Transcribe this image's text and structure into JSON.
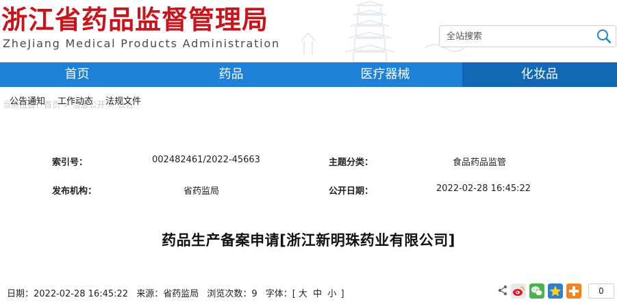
{
  "header": {
    "title": "浙江省药品监督管理局",
    "subtitle": "ZheJiang Medical Products Administration",
    "search": {
      "placeholder": "全站搜索",
      "icon": "search-icon"
    }
  },
  "nav": {
    "items": [
      {
        "label": "首页"
      },
      {
        "label": "药品"
      },
      {
        "label": "医疗器械"
      },
      {
        "label": "化妆品"
      }
    ],
    "active_index": 3,
    "color": "#1e80d6",
    "active_color": "#1368b6"
  },
  "breadcrumb_ghost": "当前位置：首页 > 信息公开 > 公告",
  "submenu": {
    "items": [
      {
        "label": "公告通知"
      },
      {
        "label": "工作动态"
      },
      {
        "label": "法规文件"
      }
    ]
  },
  "meta": {
    "index_label": "索引号：",
    "index_value": "002482461/2022-45663",
    "topic_label": "主题分类：",
    "topic_value": "食品药品监管",
    "issuer_label": "发布机构：",
    "issuer_value": "省药监局",
    "date_label": "公开日期：",
    "date_value": "2022-02-28 16:45:22"
  },
  "article": {
    "title": "药品生产备案申请[浙江新明珠药业有限公司]"
  },
  "infobar": {
    "date": "日期：2022-02-28 16:45:22",
    "source": "来源：省药监局",
    "views": "浏览次数：9",
    "font_label": "字体：[",
    "font_large": "大",
    "font_medium": "中",
    "font_small": "小",
    "font_end": "]"
  },
  "share": {
    "icons": [
      "share-icon",
      "weibo-icon",
      "wechat-icon",
      "qzone-star-icon",
      "more-plus-icon"
    ],
    "count": "0"
  },
  "colors": {
    "brand_red": "#c8141b",
    "nav_blue": "#1e80d6"
  }
}
